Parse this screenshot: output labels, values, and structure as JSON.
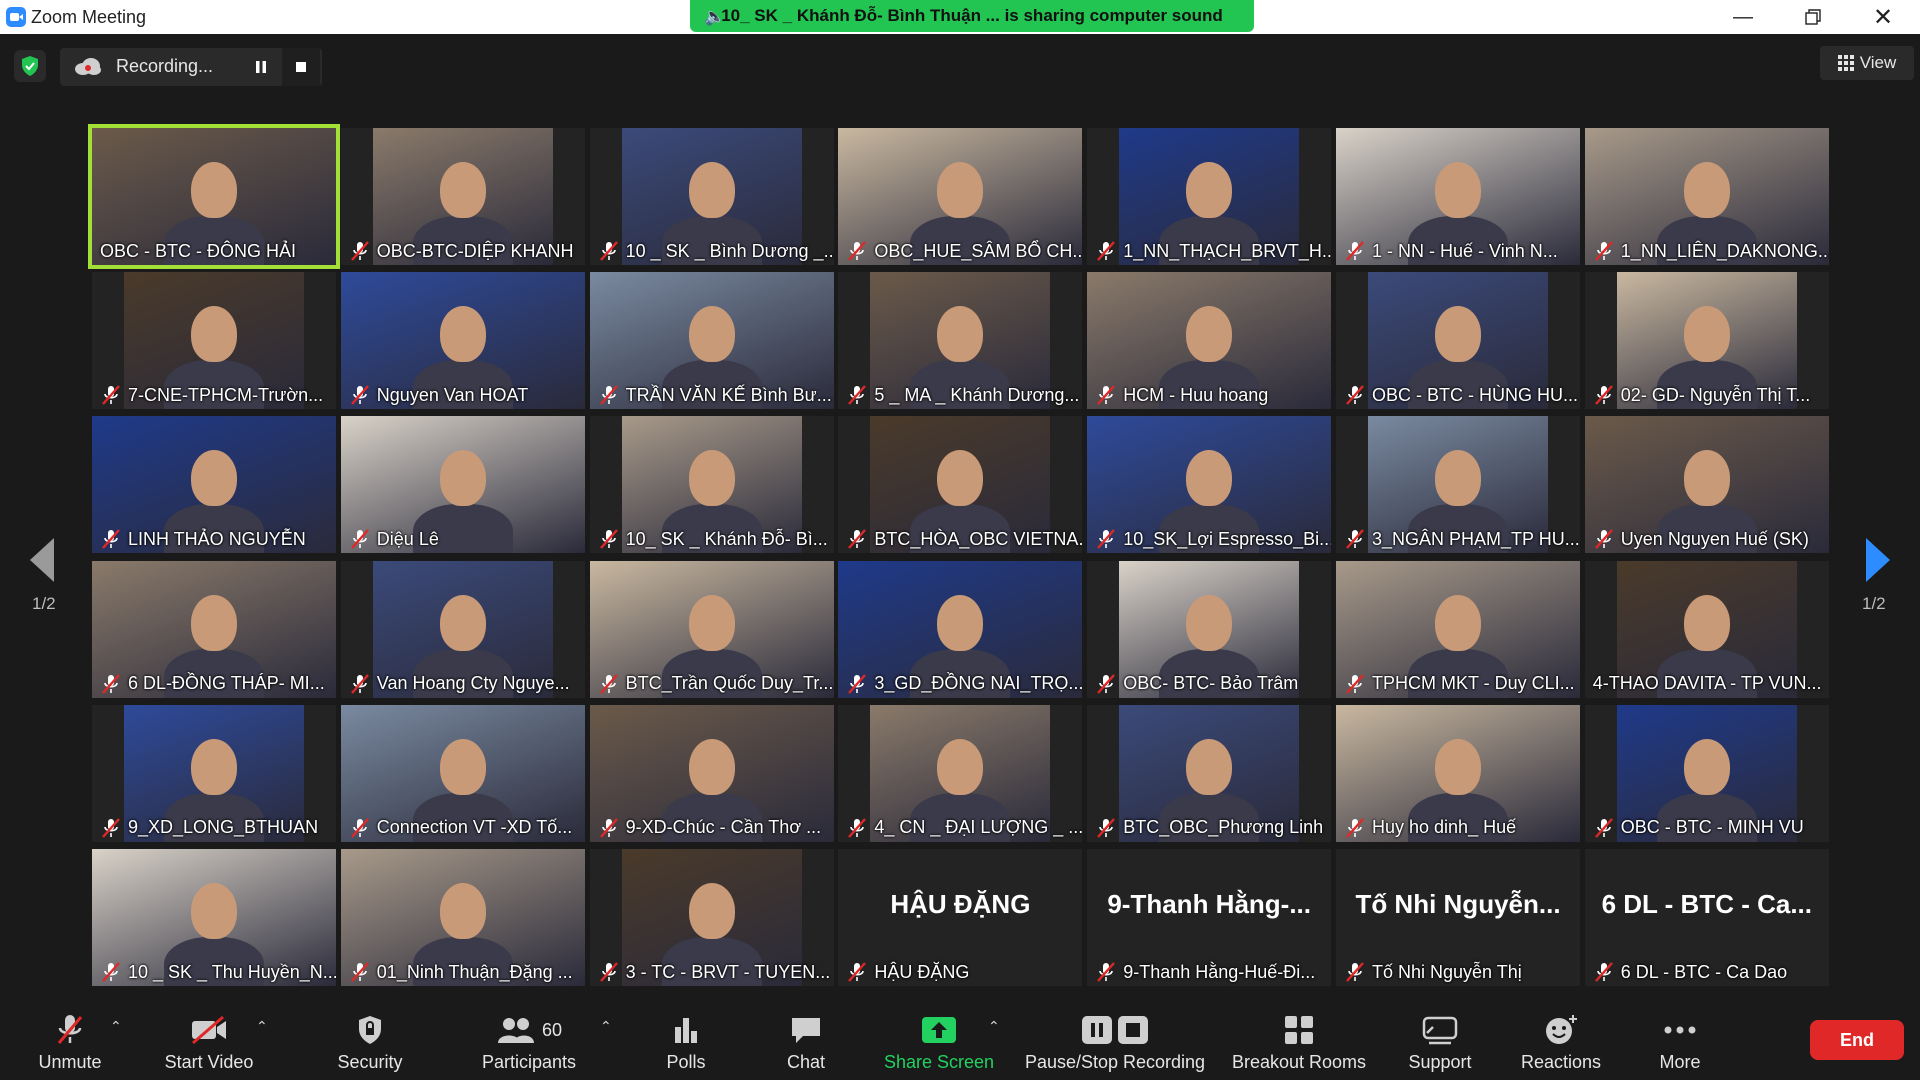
{
  "window": {
    "title": "Zoom Meeting"
  },
  "share_banner": {
    "text": "10_ SK _ Khánh Đỗ- Bình Thuận ... is sharing computer sound"
  },
  "recording": {
    "label": "Recording..."
  },
  "view_button": {
    "label": "View"
  },
  "page": {
    "left": "1/2",
    "right": "1/2"
  },
  "participants": [
    {
      "name": "OBC - BTC - ĐÔNG HẢI",
      "video": true,
      "active": true,
      "muted": false
    },
    {
      "name": "OBC-BTC-DIỆP KHANH",
      "video": true
    },
    {
      "name": "10 _ SK _ Bình Dương _...",
      "video": true
    },
    {
      "name": "OBC_HUE_SÂM BỔ CH...",
      "video": true
    },
    {
      "name": "1_NN_THẠCH_BRVT_H...",
      "video": true
    },
    {
      "name": "1 - NN - Huế - Vinh N...",
      "video": true
    },
    {
      "name": "1_NN_LIÊN_DAKNONG...",
      "video": true
    },
    {
      "name": "7-CNE-TPHCM-Trườn...",
      "video": true
    },
    {
      "name": "Nguyen Van HOAT",
      "video": true
    },
    {
      "name": "TRẦN VĂN KẾ Bình Bư...",
      "video": true
    },
    {
      "name": "5 _ MA _ Khánh Dương...",
      "video": true
    },
    {
      "name": "HCM - Huu hoang",
      "video": true
    },
    {
      "name": "OBC - BTC - HÙNG HU...",
      "video": true
    },
    {
      "name": "02- GD- Nguyễn Thị T...",
      "video": true
    },
    {
      "name": "LINH THẢO NGUYỄN",
      "video": true
    },
    {
      "name": "Diệu Lê",
      "video": true
    },
    {
      "name": "10_ SK _ Khánh Đỗ- Bì...",
      "video": true
    },
    {
      "name": "BTC_HÒA_OBC VIETNA...",
      "video": true
    },
    {
      "name": "10_SK_Lợi Espresso_Bi...",
      "video": true
    },
    {
      "name": "3_NGÂN PHẠM_TP HU...",
      "video": true
    },
    {
      "name": "Uyen Nguyen Huế (SK)",
      "video": true
    },
    {
      "name": "6 DL-ĐỒNG THÁP- MI...",
      "video": true
    },
    {
      "name": "Van Hoang Cty Nguye...",
      "video": true
    },
    {
      "name": "BTC_Trần Quốc Duy_Tr...",
      "video": true
    },
    {
      "name": "3_GD_ĐỒNG NAI_TRỌ...",
      "video": true
    },
    {
      "name": "OBC- BTC- Bảo Trâm",
      "video": true
    },
    {
      "name": "TPHCM MKT - Duy CLI...",
      "video": true
    },
    {
      "name": "4-THAO DAVITA - TP VUN...",
      "video": true,
      "muted": false
    },
    {
      "name": "9_XD_LONG_BTHUAN",
      "video": true
    },
    {
      "name": "Connection VT -XD Tố...",
      "video": true
    },
    {
      "name": "9-XD-Chúc - Cần Thơ ...",
      "video": true
    },
    {
      "name": "4_ CN _ ĐẠI LƯỢNG _ ...",
      "video": true
    },
    {
      "name": "BTC_OBC_Phương Linh",
      "video": true
    },
    {
      "name": "Huy ho dinh_ Huế",
      "video": true
    },
    {
      "name": "OBC - BTC - MINH VU",
      "video": true
    },
    {
      "name": "10 _ SK _ Thu Huyền_N...",
      "video": true
    },
    {
      "name": "01_Ninh Thuận_Đặng ...",
      "video": true
    },
    {
      "name": "3 - TC - BRVT - TUYEN...",
      "video": true
    },
    {
      "name": "HẬU ĐẶNG",
      "video": false,
      "display": "HẬU ĐẶNG"
    },
    {
      "name": "9-Thanh Hằng-Huế-Đi...",
      "video": false,
      "display": "9-Thanh  Hằng-..."
    },
    {
      "name": "Tố Nhi Nguyễn Thị",
      "video": false,
      "display": "Tố Nhi  Nguyễn..."
    },
    {
      "name": "6 DL - BTC - Ca Dao",
      "video": false,
      "display": "6 DL - BTC - Ca..."
    }
  ],
  "toolbar": {
    "unmute": "Unmute",
    "start_video": "Start Video",
    "security": "Security",
    "participants": "Participants",
    "participants_count": "60",
    "polls": "Polls",
    "chat": "Chat",
    "share_screen": "Share Screen",
    "pause_stop_recording": "Pause/Stop Recording",
    "breakout_rooms": "Breakout Rooms",
    "support": "Support",
    "reactions": "Reactions",
    "more": "More",
    "end": "End"
  },
  "colors": {
    "active_speaker": "#a3e037",
    "share_green": "#23c552",
    "end_red": "#e02828",
    "mute_red": "#e02828",
    "arrow_blue": "#2d8cff"
  }
}
